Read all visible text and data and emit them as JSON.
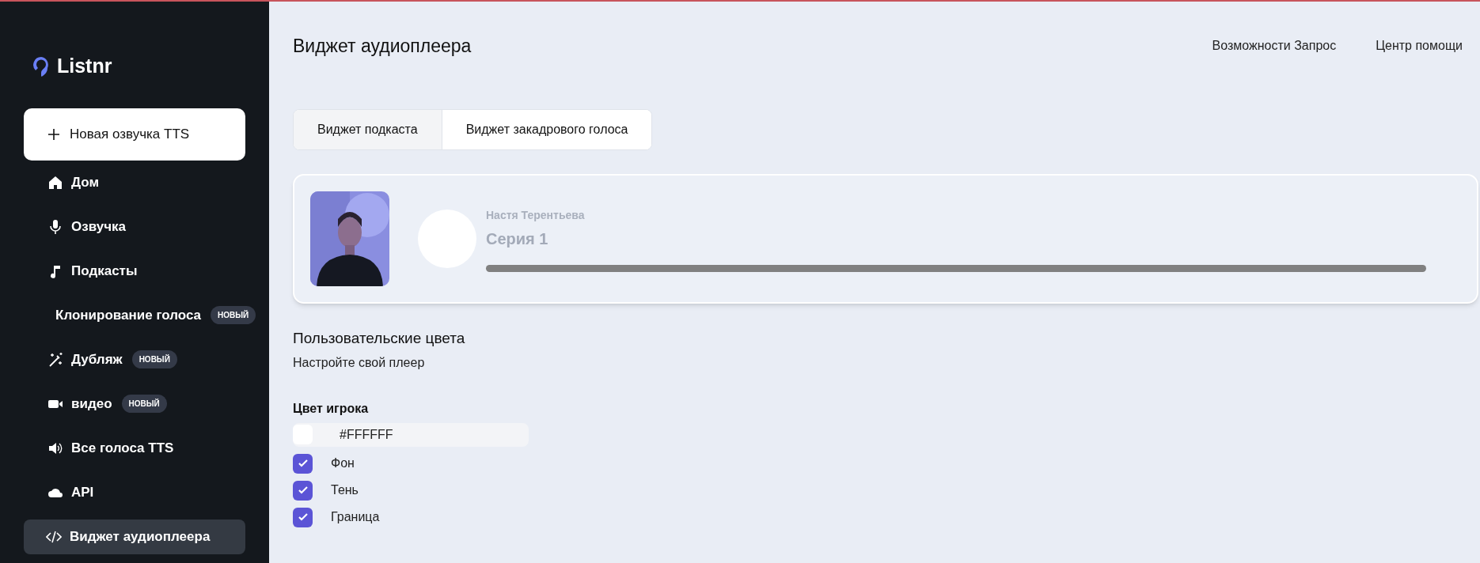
{
  "sidebar": {
    "logo": "Listnr",
    "new_button": "Новая озвучка TTS",
    "items": [
      {
        "label": "Дом",
        "selected": false
      },
      {
        "label": "Озвучка",
        "selected": false
      },
      {
        "label": "Подкасты",
        "selected": false
      },
      {
        "label": "Клонирование голоса",
        "badge": "НОВЫЙ",
        "selected": false
      },
      {
        "label": "Дубляж",
        "badge": "НОВЫЙ",
        "selected": false
      },
      {
        "label": "видео",
        "badge": "НОВЫЙ",
        "selected": false
      },
      {
        "label": "Все голоса TTS",
        "selected": false
      },
      {
        "label": "API",
        "selected": false
      },
      {
        "label": "Виджет аудиоплеера",
        "selected": true
      }
    ]
  },
  "header": {
    "title": "Виджет аудиоплеера",
    "links": [
      "Возможности Запрос",
      "Центр помощи"
    ]
  },
  "tabs": [
    {
      "label": "Виджет подкаста",
      "selected": false
    },
    {
      "label": "Виджет закадрового голоса",
      "selected": true
    }
  ],
  "player": {
    "artist": "Настя Терентьева",
    "episode": "Серия 1"
  },
  "custom_colors": {
    "title": "Пользовательские цвета",
    "subtitle": "Настройте свой плеер",
    "color_label": "Цвет игрока",
    "color_value": "#FFFFFF",
    "options": [
      {
        "label": "Фон",
        "checked": true
      },
      {
        "label": "Тень",
        "checked": true
      },
      {
        "label": "Граница",
        "checked": true
      }
    ]
  }
}
